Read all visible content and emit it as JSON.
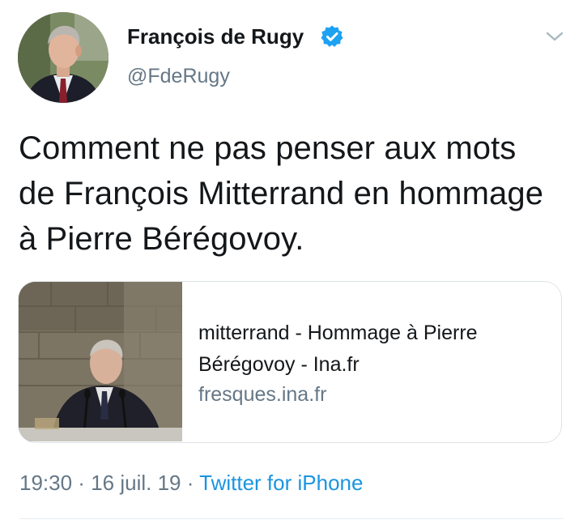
{
  "author": {
    "name": "François de Rugy",
    "handle": "@FdeRugy",
    "verified": true
  },
  "tweet": {
    "text": "Comment ne pas penser aux mots de François Mitterrand en hommage à Pierre Bérégovoy."
  },
  "card": {
    "title": "mitterrand - Hommage à Pierre Bérégovoy - Ina.fr",
    "domain": "fresques.ina.fr"
  },
  "meta": {
    "time": "19:30",
    "separator": " · ",
    "date": "16 juil. 19",
    "source": "Twitter for iPhone"
  },
  "icons": {
    "verified": "verified-badge-icon",
    "menu": "chevron-down-icon"
  },
  "colors": {
    "link": "#1b95e0",
    "secondary": "#657786",
    "text": "#14171a",
    "verified": "#1da1f2"
  }
}
